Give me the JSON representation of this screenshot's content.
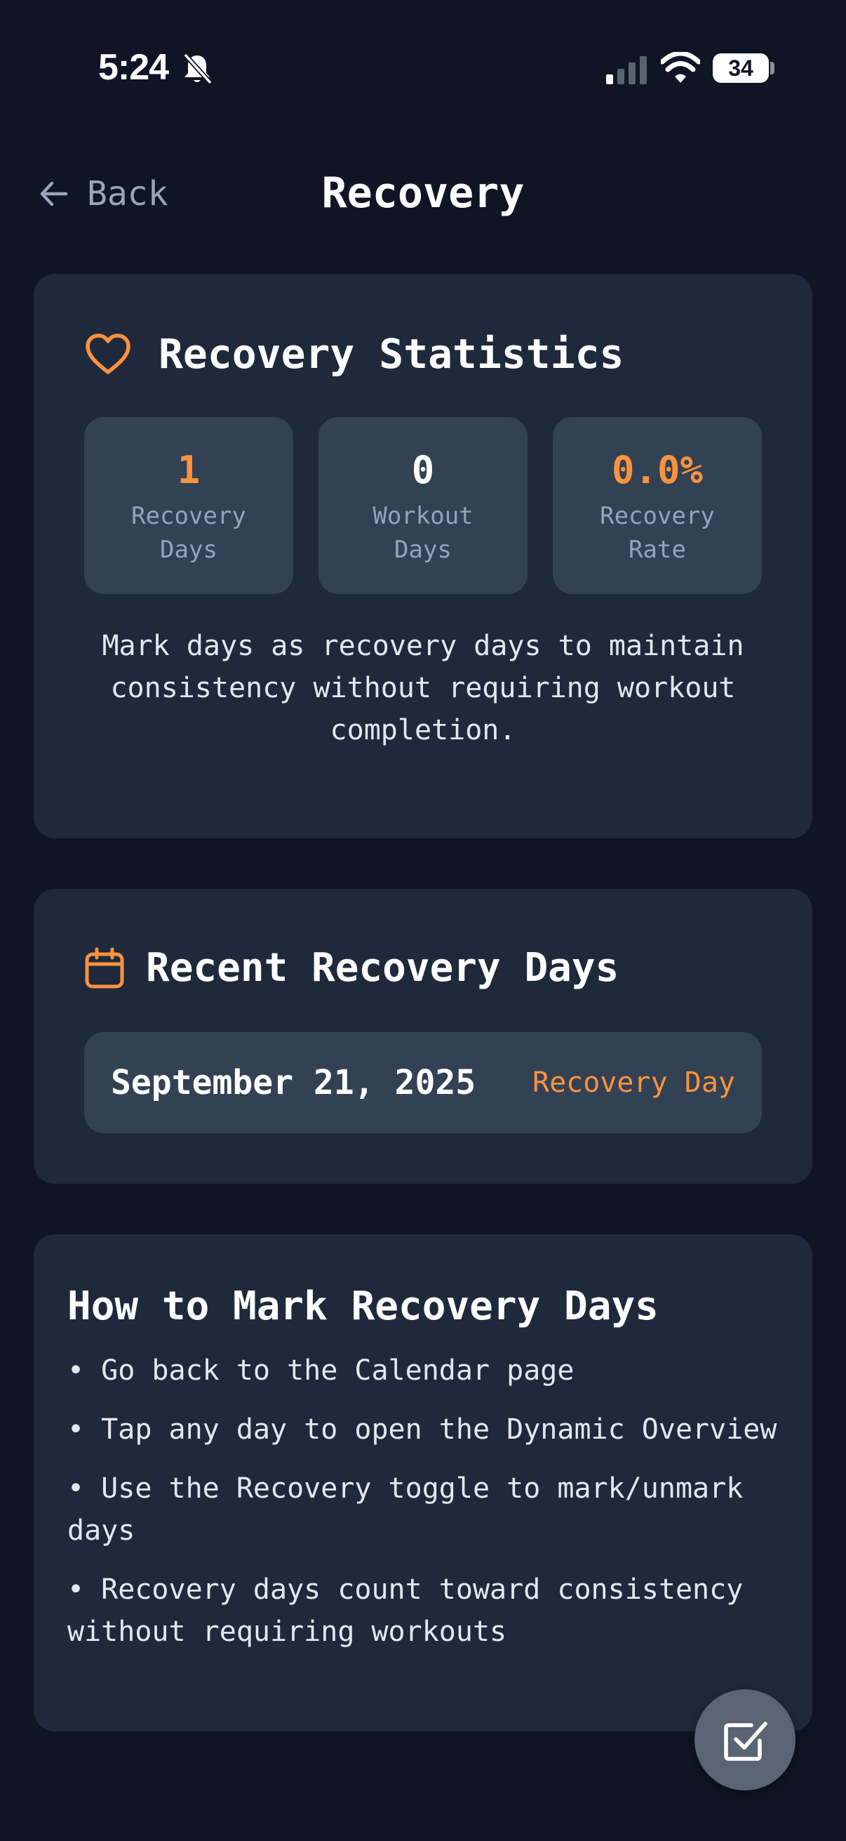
{
  "status_bar": {
    "time": "5:24",
    "battery": "34",
    "icons": [
      "bell-slash-icon",
      "signal-icon",
      "wifi-icon",
      "battery-icon"
    ]
  },
  "header": {
    "back_label": "Back",
    "title": "Recovery"
  },
  "stats_card": {
    "title": "Recovery Statistics",
    "icon": "heart-icon",
    "stats": [
      {
        "value": "1",
        "label": "Recovery Days"
      },
      {
        "value": "0",
        "label": "Workout Days"
      },
      {
        "value": "0.0%",
        "label": "Recovery Rate"
      }
    ],
    "description": "Mark days as recovery days to maintain consistency without requiring workout completion."
  },
  "recent_card": {
    "title": "Recent Recovery Days",
    "icon": "calendar-icon",
    "entries": [
      {
        "date": "September 21, 2025",
        "tag": "Recovery Day"
      }
    ]
  },
  "howto_card": {
    "title": "How to Mark Recovery Days",
    "steps": [
      "• Go back to the Calendar page",
      "• Tap any day to open the Dynamic Overview",
      "• Use the Recovery toggle to mark/unmark days",
      "• Recovery days count toward consistency without requiring workouts"
    ]
  },
  "fab": {
    "icon": "checkbox-icon"
  },
  "colors": {
    "background": "#0f1525",
    "card": "#1e293b",
    "tile": "#334155",
    "accent": "#fb923c",
    "muted_text": "#94a3b8"
  }
}
